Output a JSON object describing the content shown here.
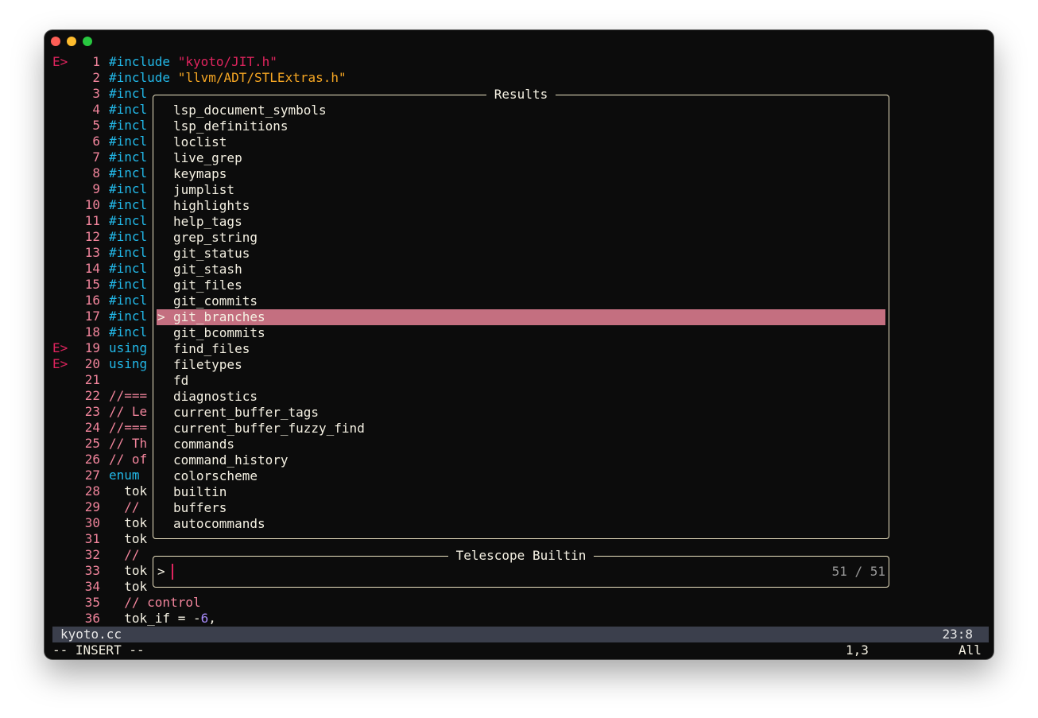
{
  "window": {
    "controls": [
      "close",
      "minimize",
      "maximize"
    ]
  },
  "editor": {
    "lines": [
      {
        "sign": "E>",
        "num": "1",
        "parts": [
          {
            "t": "#include ",
            "c": "#22b8e8"
          },
          {
            "t": "\"kyoto/JIT.h\"",
            "c": "#e0245e"
          }
        ]
      },
      {
        "sign": "",
        "num": "2",
        "parts": [
          {
            "t": "#include ",
            "c": "#22b8e8"
          },
          {
            "t": "\"llvm/ADT/STLExtras.h\"",
            "c": "#f5a623"
          }
        ]
      },
      {
        "sign": "",
        "num": "3",
        "parts": [
          {
            "t": "#incl",
            "c": "#22b8e8"
          }
        ]
      },
      {
        "sign": "",
        "num": "4",
        "parts": [
          {
            "t": "#incl",
            "c": "#22b8e8"
          }
        ]
      },
      {
        "sign": "",
        "num": "5",
        "parts": [
          {
            "t": "#incl",
            "c": "#22b8e8"
          }
        ]
      },
      {
        "sign": "",
        "num": "6",
        "parts": [
          {
            "t": "#incl",
            "c": "#22b8e8"
          }
        ]
      },
      {
        "sign": "",
        "num": "7",
        "parts": [
          {
            "t": "#incl",
            "c": "#22b8e8"
          }
        ]
      },
      {
        "sign": "",
        "num": "8",
        "parts": [
          {
            "t": "#incl",
            "c": "#22b8e8"
          }
        ]
      },
      {
        "sign": "",
        "num": "9",
        "parts": [
          {
            "t": "#incl",
            "c": "#22b8e8"
          }
        ]
      },
      {
        "sign": "",
        "num": "10",
        "parts": [
          {
            "t": "#incl",
            "c": "#22b8e8"
          }
        ]
      },
      {
        "sign": "",
        "num": "11",
        "parts": [
          {
            "t": "#incl",
            "c": "#22b8e8"
          }
        ]
      },
      {
        "sign": "",
        "num": "12",
        "parts": [
          {
            "t": "#incl",
            "c": "#22b8e8"
          }
        ]
      },
      {
        "sign": "",
        "num": "13",
        "parts": [
          {
            "t": "#incl",
            "c": "#22b8e8"
          }
        ]
      },
      {
        "sign": "",
        "num": "14",
        "parts": [
          {
            "t": "#incl",
            "c": "#22b8e8"
          }
        ]
      },
      {
        "sign": "",
        "num": "15",
        "parts": [
          {
            "t": "#incl",
            "c": "#22b8e8"
          }
        ]
      },
      {
        "sign": "",
        "num": "16",
        "parts": [
          {
            "t": "#incl",
            "c": "#22b8e8"
          }
        ]
      },
      {
        "sign": "",
        "num": "17",
        "parts": [
          {
            "t": "#incl",
            "c": "#22b8e8"
          }
        ]
      },
      {
        "sign": "",
        "num": "18",
        "parts": [
          {
            "t": "#incl",
            "c": "#22b8e8"
          }
        ]
      },
      {
        "sign": "E>",
        "num": "19",
        "parts": [
          {
            "t": "using",
            "c": "#22b8e8"
          }
        ]
      },
      {
        "sign": "E>",
        "num": "20",
        "parts": [
          {
            "t": "using",
            "c": "#22b8e8"
          }
        ]
      },
      {
        "sign": "",
        "num": "21",
        "parts": []
      },
      {
        "sign": "",
        "num": "22",
        "parts": [
          {
            "t": "//===",
            "c": "#f2859c"
          }
        ]
      },
      {
        "sign": "",
        "num": "23",
        "parts": [
          {
            "t": "// Le",
            "c": "#f2859c"
          }
        ]
      },
      {
        "sign": "",
        "num": "24",
        "parts": [
          {
            "t": "//===",
            "c": "#f2859c"
          }
        ]
      },
      {
        "sign": "",
        "num": "25",
        "parts": [
          {
            "t": "// Th",
            "c": "#f2859c"
          }
        ]
      },
      {
        "sign": "",
        "num": "26",
        "parts": [
          {
            "t": "// of",
            "c": "#f2859c"
          }
        ]
      },
      {
        "sign": "",
        "num": "27",
        "parts": [
          {
            "t": "enum",
            "c": "#22b8e8"
          }
        ]
      },
      {
        "sign": "",
        "num": "28",
        "parts": [
          {
            "t": "  tok",
            "c": "#f5f1e3"
          }
        ]
      },
      {
        "sign": "",
        "num": "29",
        "parts": [
          {
            "t": "  //",
            "c": "#f2859c"
          }
        ]
      },
      {
        "sign": "",
        "num": "30",
        "parts": [
          {
            "t": "  tok",
            "c": "#f5f1e3"
          }
        ]
      },
      {
        "sign": "",
        "num": "31",
        "parts": [
          {
            "t": "  tok",
            "c": "#f5f1e3"
          }
        ]
      },
      {
        "sign": "",
        "num": "32",
        "parts": [
          {
            "t": "  //",
            "c": "#f2859c"
          }
        ]
      },
      {
        "sign": "",
        "num": "33",
        "parts": [
          {
            "t": "  tok",
            "c": "#f5f1e3"
          }
        ]
      },
      {
        "sign": "",
        "num": "34",
        "parts": [
          {
            "t": "  tok",
            "c": "#f5f1e3"
          }
        ]
      },
      {
        "sign": "",
        "num": "35",
        "parts": [
          {
            "t": "  // control",
            "c": "#f2859c"
          }
        ]
      },
      {
        "sign": "",
        "num": "36",
        "parts": [
          {
            "t": "  tok_if = -",
            "c": "#f5f1e3"
          },
          {
            "t": "6",
            "c": "#a78bfa"
          },
          {
            "t": ",",
            "c": "#f5f1e3"
          }
        ]
      }
    ]
  },
  "results": {
    "title": "Results",
    "caret": ">",
    "selected_index": 13,
    "items": [
      "lsp_document_symbols",
      "lsp_definitions",
      "loclist",
      "live_grep",
      "keymaps",
      "jumplist",
      "highlights",
      "help_tags",
      "grep_string",
      "git_status",
      "git_stash",
      "git_files",
      "git_commits",
      "git_branches",
      "git_bcommits",
      "find_files",
      "filetypes",
      "fd",
      "diagnostics",
      "current_buffer_tags",
      "current_buffer_fuzzy_find",
      "commands",
      "command_history",
      "colorscheme",
      "builtin",
      "buffers",
      "autocommands"
    ]
  },
  "prompt": {
    "title": "Telescope Builtin",
    "caret": ">",
    "value": "",
    "count": "51 / 51"
  },
  "statusline": {
    "filename": "kyoto.cc",
    "position": "23:8"
  },
  "modeline": {
    "mode": "-- INSERT --",
    "cursor": "1,3",
    "scroll": "All"
  },
  "colors": {
    "background": "#0c0c0c",
    "selection": "#c46f80",
    "border": "#ece3c2",
    "line_number": "#f2859c",
    "error_sign": "#e0245e",
    "statusline_bg": "#3b3f4c"
  }
}
